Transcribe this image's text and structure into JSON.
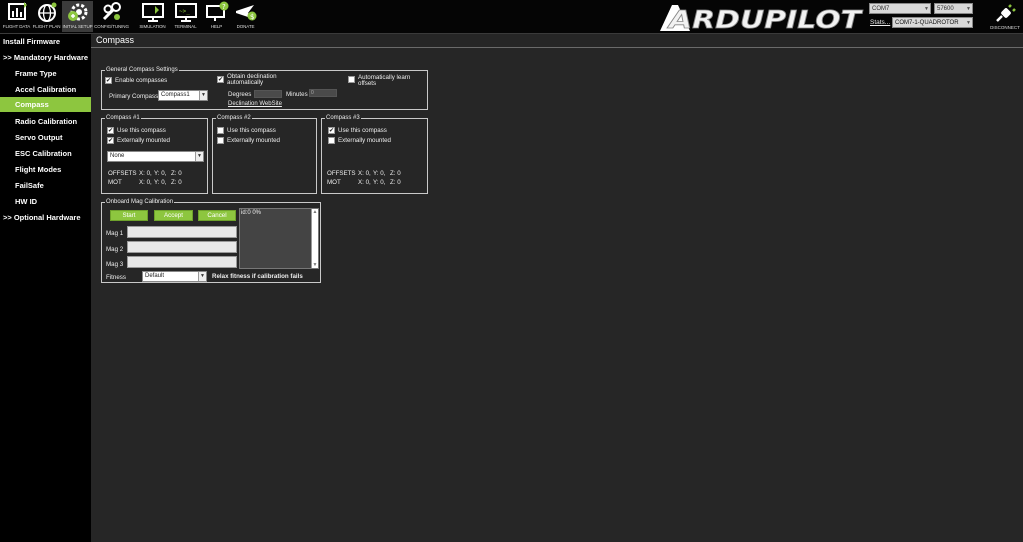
{
  "toolbar": {
    "buttons": [
      {
        "label": "FLIGHT DATA",
        "icon": "flight-data-icon"
      },
      {
        "label": "FLIGHT PLAN",
        "icon": "flight-plan-icon"
      },
      {
        "label": "INITIAL SETUP",
        "icon": "initial-setup-icon"
      },
      {
        "label": "CONFIG/TUNING",
        "icon": "config-tuning-icon"
      },
      {
        "label": "SIMULATION",
        "icon": "simulation-icon"
      },
      {
        "label": "TERMINAL",
        "icon": "terminal-icon"
      },
      {
        "label": "HELP",
        "icon": "help-icon"
      },
      {
        "label": "DONATE",
        "icon": "donate-icon"
      }
    ],
    "logo_text": "ARDUPILOT",
    "port": "COM7",
    "baud": "57600",
    "stats_label": "Stats...",
    "vehicle": "COM7-1-QUADROTOR",
    "disconnect_label": "DISCONNECT",
    "colors": {
      "accent": "#8dc63f",
      "background": "#262626",
      "toolbar": "#050505"
    }
  },
  "sidebar": {
    "items": [
      {
        "label": "Install Firmware"
      },
      {
        "label": ">> Mandatory Hardware"
      },
      {
        "label": "Frame Type"
      },
      {
        "label": "Accel Calibration"
      },
      {
        "label": "Compass"
      },
      {
        "label": "Radio Calibration"
      },
      {
        "label": "Servo Output"
      },
      {
        "label": "ESC Calibration"
      },
      {
        "label": "Flight Modes"
      },
      {
        "label": "FailSafe"
      },
      {
        "label": "HW ID"
      },
      {
        "label": ">> Optional Hardware"
      }
    ],
    "selected": "Compass"
  },
  "main": {
    "title": "Compass",
    "general": {
      "title": "General Compass Settings",
      "enable_label": "Enable compasses",
      "enable_checked": true,
      "primary_label": "Primary Compass",
      "primary_value": "Compass1",
      "obtain_label_1": "Obtain declination",
      "obtain_label_2": "automatically",
      "obtain_checked": true,
      "degrees_label": "Degrees",
      "minutes_label": "Minutes",
      "minutes_value": "0",
      "website_link": "Declination WebSite",
      "auto_learn_label_1": "Automatically learn",
      "auto_learn_label_2": "offsets",
      "auto_learn_checked": false
    },
    "compass1": {
      "title": "Compass #1",
      "use_label": "Use this compass",
      "use_checked": true,
      "ext_label": "Externally mounted",
      "ext_checked": true,
      "orientation": "None",
      "offsets_label": "OFFSETS",
      "offsets_x": "X: 0,",
      "offsets_y": "Y: 0,",
      "offsets_z": "Z: 0",
      "mot_label": "MOT",
      "mot_x": "X: 0,",
      "mot_y": "Y: 0,",
      "mot_z": "Z: 0"
    },
    "compass2": {
      "title": "Compass #2",
      "use_label": "Use this compass",
      "use_checked": false,
      "ext_label": "Externally mounted",
      "ext_checked": false
    },
    "compass3": {
      "title": "Compass #3",
      "use_label": "Use this compass",
      "use_checked": true,
      "ext_label": "Externally mounted",
      "ext_checked": false,
      "offsets_label": "OFFSETS",
      "offsets_x": "X: 0,",
      "offsets_y": "Y: 0,",
      "offsets_z": "Z: 0",
      "mot_label": "MOT",
      "mot_x": "X: 0,",
      "mot_y": "Y: 0,",
      "mot_z": "Z: 0"
    },
    "mag_cal": {
      "title": "Onboard Mag Calibration",
      "start_label": "Start",
      "accept_label": "Accept",
      "cancel_label": "Cancel",
      "mag1_label": "Mag 1",
      "mag2_label": "Mag 2",
      "mag3_label": "Mag 3",
      "log_text": "id:0 0%",
      "fitness_label": "Fitness",
      "fitness_value": "Default",
      "relax_label": "Relax fitness if calibration fails",
      "relax_checked": false
    }
  }
}
